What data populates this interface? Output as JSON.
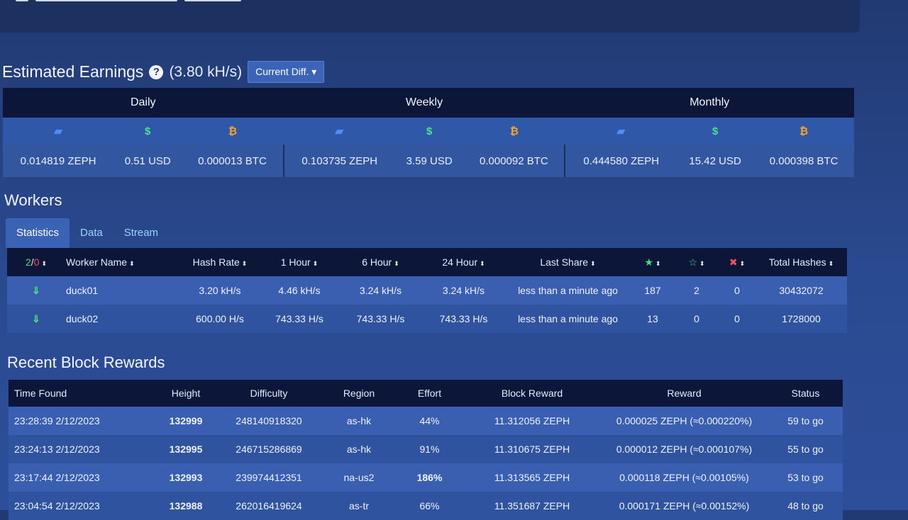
{
  "earnings": {
    "title": "Estimated Earnings",
    "help_icon": "?",
    "hashrate": "(3.80 kH/s)",
    "diff_button": "Current Diff. ▾",
    "periods": [
      "Daily",
      "Weekly",
      "Monthly"
    ],
    "icons": [
      "zeph-coin-icon",
      "dollar-icon",
      "bitcoin-icon"
    ],
    "icon_glyphs": [
      "▰",
      "$",
      "₿"
    ],
    "values": [
      [
        "0.014819 ZEPH",
        "0.51 USD",
        "0.000013 BTC"
      ],
      [
        "0.103735 ZEPH",
        "3.59 USD",
        "0.000092 BTC"
      ],
      [
        "0.444580 ZEPH",
        "15.42 USD",
        "0.000398 BTC"
      ]
    ]
  },
  "workers": {
    "title": "Workers",
    "tabs": [
      "Statistics",
      "Data",
      "Stream"
    ],
    "active_tab": "Statistics",
    "count_online": "2",
    "count_sep": "/",
    "count_offline": "0",
    "columns": [
      "Worker Name",
      "Hash Rate",
      "1 Hour",
      "6 Hour",
      "24 Hour",
      "Last Share",
      "★",
      "☆",
      "✖",
      "Total Hashes"
    ],
    "rows": [
      {
        "name": "duck01",
        "hash_rate": "3.20 kH/s",
        "h1": "4.46 kH/s",
        "h6": "3.24 kH/s",
        "h24": "3.24 kH/s",
        "last_share": "less than a minute ago",
        "valid": "187",
        "stale": "2",
        "invalid": "0",
        "total": "30432072"
      },
      {
        "name": "duck02",
        "hash_rate": "600.00 H/s",
        "h1": "743.33 H/s",
        "h6": "743.33 H/s",
        "h24": "743.33 H/s",
        "last_share": "less than a minute ago",
        "valid": "13",
        "stale": "0",
        "invalid": "0",
        "total": "1728000"
      }
    ]
  },
  "blocks": {
    "title": "Recent Block Rewards",
    "columns": [
      "Time Found",
      "Height",
      "Difficulty",
      "Region",
      "Effort",
      "Block Reward",
      "Reward",
      "Status"
    ],
    "rows": [
      {
        "time": "23:28:39 2/12/2023",
        "height": "132999",
        "difficulty": "248140918320",
        "region": "as-hk",
        "effort": "44%",
        "block_reward": "11.312056 ZEPH",
        "reward": "0.000025 ZEPH (≈0.000220%)",
        "status": "59 to go"
      },
      {
        "time": "23:24:13 2/12/2023",
        "height": "132995",
        "difficulty": "246715286869",
        "region": "as-hk",
        "effort": "91%",
        "block_reward": "11.310675 ZEPH",
        "reward": "0.000012 ZEPH (≈0.000107%)",
        "status": "55 to go"
      },
      {
        "time": "23:17:44 2/12/2023",
        "height": "132993",
        "difficulty": "239974412351",
        "region": "na-us2",
        "effort": "186%",
        "block_reward": "11.313565 ZEPH",
        "reward": "0.000118 ZEPH (≈0.00105%)",
        "status": "53 to go"
      },
      {
        "time": "23:04:54 2/12/2023",
        "height": "132988",
        "difficulty": "262016419624",
        "region": "as-tr",
        "effort": "66%",
        "block_reward": "11.351687 ZEPH",
        "reward": "0.000171 ZEPH (≈0.00152%)",
        "status": "48 to go"
      }
    ]
  },
  "colors": {
    "accent": "#3a62b5",
    "header_bg": "#0c1638",
    "green": "#44e07e",
    "orange": "#ffb05a",
    "red": "#ff4a5a"
  }
}
